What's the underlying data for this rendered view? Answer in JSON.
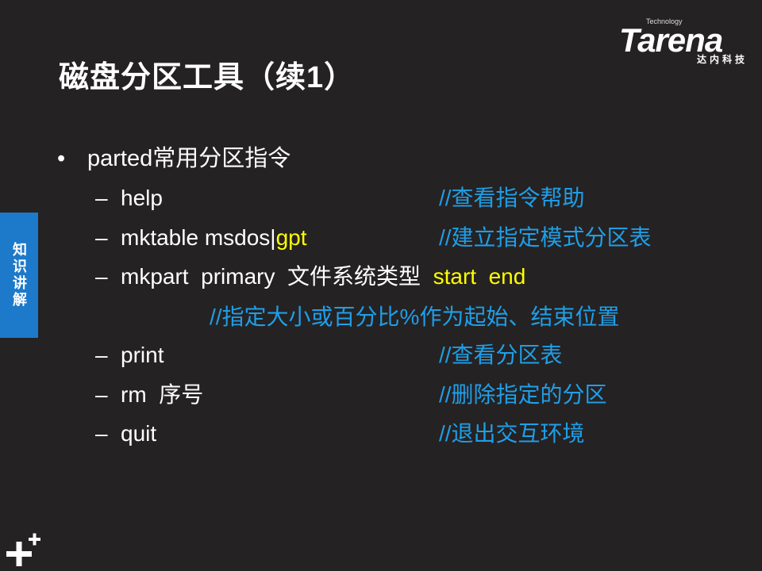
{
  "slide": {
    "title": "磁盘分区工具（续1）",
    "side_tab": "知识讲解",
    "logo": {
      "brand": "Tarena",
      "tagline": "Technology",
      "cn_name": "达内科技"
    },
    "bullet": {
      "symbol": "•",
      "text": "parted常用分区指令"
    },
    "items": [
      {
        "dash": "–",
        "cmd": "help",
        "comment": "//查看指令帮助"
      },
      {
        "dash": "–",
        "cmd": "mktable  msdos|",
        "cmd_highlight": "gpt",
        "comment": "//建立指定模式分区表"
      },
      {
        "dash": "–",
        "cmd": "mkpart  primary  文件系统类型  ",
        "cmd_highlight": "start  end"
      },
      {
        "dash": "–",
        "cmd": "print",
        "comment": "//查看分区表"
      },
      {
        "dash": "–",
        "cmd": "rm  序号",
        "comment": "//删除指定的分区"
      },
      {
        "dash": "–",
        "cmd": "quit",
        "comment": "//退出交互环境"
      }
    ],
    "mkpart_comment": "//指定大小或百分比%作为起始、结束位置",
    "colors": {
      "background": "#252223",
      "comment": "#1e9fe8",
      "highlight": "#ffff00",
      "side_tab": "#1d79c9"
    },
    "icons": {
      "corner": "plus-icon"
    }
  }
}
